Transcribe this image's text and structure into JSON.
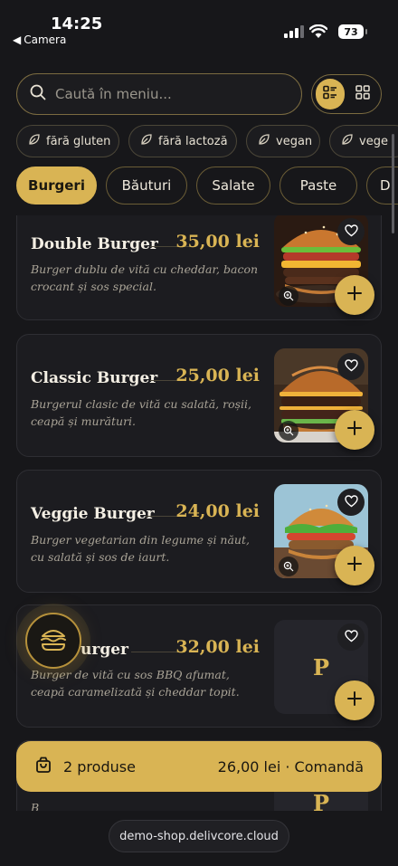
{
  "status_bar": {
    "time": "14:25",
    "back_app": "Camera",
    "battery": "73"
  },
  "search": {
    "placeholder": "Caută în meniu..."
  },
  "dietary_filters": [
    {
      "label": "fără gluten"
    },
    {
      "label": "fără lactoză"
    },
    {
      "label": "vegan"
    },
    {
      "label": "vege"
    }
  ],
  "categories": [
    {
      "label": "Burgeri",
      "active": true
    },
    {
      "label": "Băuturi"
    },
    {
      "label": "Salate"
    },
    {
      "label": "Paste"
    },
    {
      "label": "D"
    }
  ],
  "items": [
    {
      "name": "Double Burger",
      "price": "35,00 lei",
      "desc": "Burger dublu de vită cu cheddar, bacon crocant și sos special.",
      "image": "burger-photo"
    },
    {
      "name": "Classic Burger",
      "price": "25,00 lei",
      "desc": "Burgerul clasic de vită cu salată, roșii, ceapă și murături.",
      "image": "burger-photo"
    },
    {
      "name": "Veggie Burger",
      "price": "24,00 lei",
      "desc": "Burger vegetarian din legume și năut, cu salată și sos de iaurt.",
      "image": "burger-photo"
    },
    {
      "name": "urger",
      "price": "32,00 lei",
      "desc": "Burger de vită cu sos BBQ afumat, ceapă caramelizată și cheddar topit.",
      "image_placeholder": "P"
    },
    {
      "name": "",
      "price": "",
      "desc": "B",
      "image_placeholder": "P"
    }
  ],
  "cart": {
    "count": "2 produse",
    "total": "26,00 lei · Comandă"
  },
  "url": "demo-shop.delivcore.cloud",
  "colors": {
    "accent": "#d9b454",
    "background": "#17171a",
    "card": "#1c1c20"
  },
  "icons": [
    "search-icon",
    "list-view-icon",
    "grid-view-icon",
    "leaf-icon",
    "heart-icon",
    "zoom-icon",
    "plus-icon",
    "burger-icon",
    "shopping-bag-icon"
  ]
}
